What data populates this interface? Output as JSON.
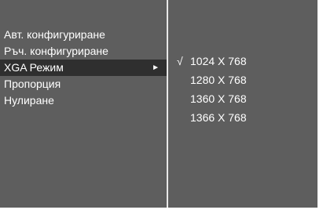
{
  "menu": {
    "items": [
      {
        "label": "Авт. конфигуриране"
      },
      {
        "label": "Ръч. конфигуриране"
      },
      {
        "label": "XGA Режим",
        "submenu_icon": "play-arrow-icon",
        "submenu_glyph": "►"
      },
      {
        "label": "Пропорция"
      },
      {
        "label": "Нулиране"
      }
    ],
    "selected_index": 2
  },
  "submenu": {
    "check_glyph": "√",
    "check_icon": "checkmark-icon",
    "options": [
      {
        "label": "1024 X 768",
        "checked": true
      },
      {
        "label": "1280 X 768",
        "checked": false
      },
      {
        "label": "1360 X 768",
        "checked": false
      },
      {
        "label": "1366 X 768",
        "checked": false
      }
    ]
  },
  "colors": {
    "panel_background": "#5e5e5e",
    "selected_background": "#2f2f2f",
    "divider": "#e8e8e8",
    "text": "#ffffff"
  }
}
